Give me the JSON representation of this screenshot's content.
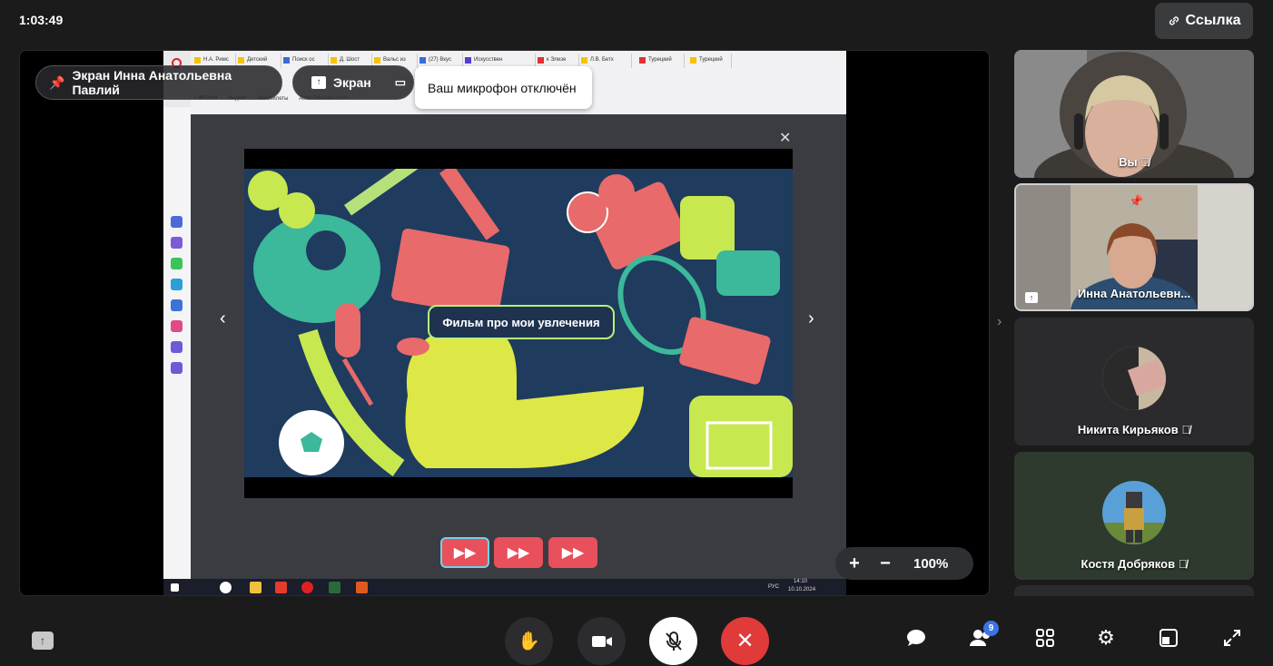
{
  "header": {
    "timer": "1:03:49",
    "link_label": "Ссылка"
  },
  "stage": {
    "presenter_chip": "Экран Инна Анатольевна Павлий",
    "screen_chip": "Экран",
    "mic_tooltip": "Ваш микрофон отключён",
    "film_title": "Фильм про мои увлечения",
    "zoom_level": "100%",
    "zoom_in": "+",
    "zoom_out": "−"
  },
  "shared_browser": {
    "tabs": [
      "Н.А. Римс",
      "Детский",
      "Поиск ос",
      "Д. Шост",
      "Вальс из",
      "(27) Вкус",
      "Искусствен",
      "к Элизе",
      "Л.В. Бетх",
      "Турецкий",
      "Турецкий"
    ],
    "bookmarks": [
      "СФЕРУМ",
      "Яндекс",
      "Авиабилеты",
      "Abon.Donvoda.Com..."
    ],
    "taskbar_lang": "РУС",
    "taskbar_time": "14:10",
    "taskbar_date": "10.10.2024"
  },
  "participants": [
    {
      "name": "Вы",
      "muted": true
    },
    {
      "name": "Инна Анатольевн...",
      "pinned": true,
      "sharing": true
    },
    {
      "name": "Никита Кирьяков",
      "muted": true
    },
    {
      "name": "Костя Добряков",
      "muted": true
    }
  ],
  "controls": {
    "participants_count": "9"
  },
  "colors": {
    "background": "#1b1b1c",
    "end_call": "#e03a3a",
    "accent_badge": "#3a73e6"
  }
}
